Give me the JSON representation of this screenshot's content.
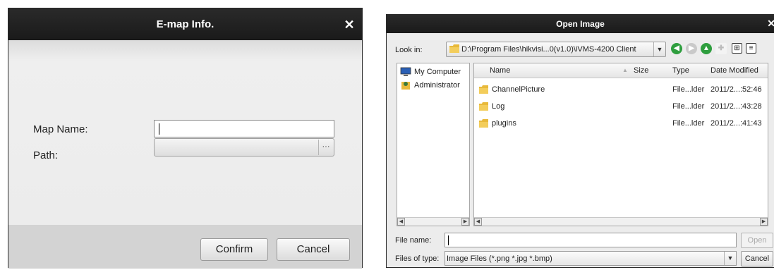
{
  "emap_dialog": {
    "title": "E-map Info.",
    "close_glyph": "✕",
    "map_name_label": "Map Name:",
    "map_name_value": "",
    "path_label": "Path:",
    "path_value": "",
    "browse_glyph": "···",
    "confirm_label": "Confirm",
    "cancel_label": "Cancel"
  },
  "open_dialog": {
    "title": "Open Image",
    "close_glyph": "✕",
    "look_in_label": "Look in:",
    "look_in_path": "D:\\Program Files\\hikvisi...0(v1.0)\\iVMS-4200 Client",
    "toolbar_icons": [
      "back-icon",
      "forward-icon",
      "parent-folder-icon",
      "new-folder-icon",
      "list-view-icon",
      "detail-view-icon"
    ],
    "places": [
      {
        "label": "My Computer",
        "icon": "computer-icon"
      },
      {
        "label": "Administrator",
        "icon": "user-icon"
      }
    ],
    "columns": {
      "name": "Name",
      "size": "Size",
      "type": "Type",
      "date": "Date Modified"
    },
    "files": [
      {
        "name": "ChannelPicture",
        "size": "",
        "type": "File...lder",
        "date": "2011/2...:52:46"
      },
      {
        "name": "Log",
        "size": "",
        "type": "File...lder",
        "date": "2011/2...:43:28"
      },
      {
        "name": "plugins",
        "size": "",
        "type": "File...lder",
        "date": "2011/2...:41:43"
      }
    ],
    "file_name_label": "File name:",
    "file_name_value": "",
    "open_label": "Open",
    "files_of_type_label": "Files of type:",
    "files_of_type_value": "Image Files (*.png *.jpg *.bmp)",
    "cancel_label": "Cancel"
  },
  "colors": {
    "titlebar": "#1f1f1f",
    "dialog_bg": "#ececec",
    "folder_yellow": "#e8b93a",
    "nav_green": "#2e9e3e"
  }
}
